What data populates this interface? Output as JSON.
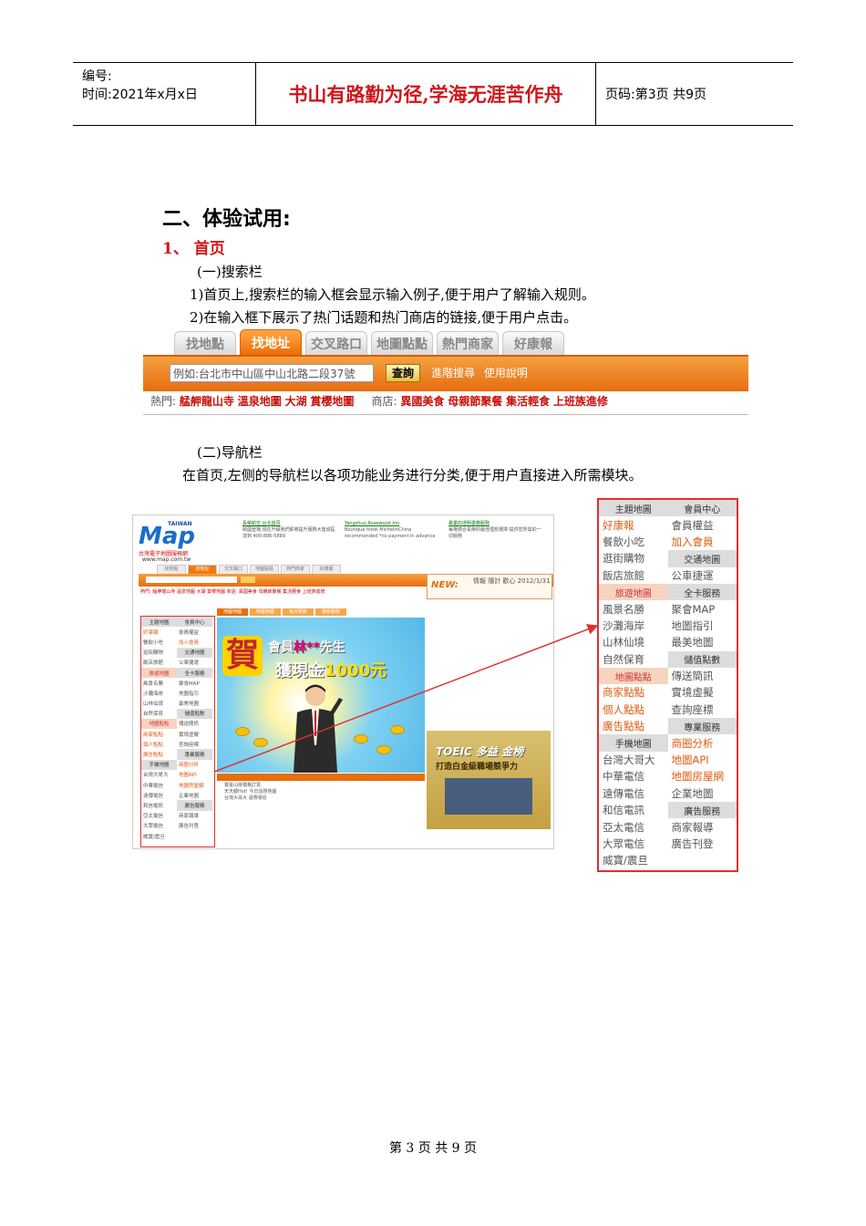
{
  "header": {
    "code_label": "编号:",
    "time_label": "时间:2021年x月x日",
    "motto": "书山有路勤为径,学海无涯苦作舟",
    "page_label": "页码:第3页 共9页"
  },
  "section_title": "二、体验试用:",
  "sub_title": "1、 首页",
  "search_heading": "(一)搜索栏",
  "search_point1": "1)首页上,搜索栏的输入框会显示输入例子,便于用户了解输入规则。",
  "search_point2": "2)在输入框下展示了热门话题和热门商店的链接,便于用户点击。",
  "search_ui": {
    "tabs": [
      "找地點",
      "找地址",
      "交叉路口",
      "地圖點點",
      "熱門商家",
      "好康報"
    ],
    "active_tab": "找地址",
    "input_placeholder": "例如:台北市中山區中山北路二段37號",
    "search_button": "查詢",
    "advanced_link": "進階搜尋",
    "help_link": "使用說明",
    "hot_label": "熱門:",
    "hot_links": [
      "艋舺龍山寺",
      "溫泉地圖",
      "大湖",
      "賞櫻地圖"
    ],
    "shop_label": "商店:",
    "shop_links": [
      "異國美食",
      "母親節聚餐",
      "集活輕食",
      "上班族進修"
    ]
  },
  "nav_heading": "(二)导航栏",
  "nav_desc": "在首页,左侧的导航栏以各项功能业务进行分类,便于用户直接进入所需模块。",
  "screenshot": {
    "logo_word": "Map",
    "logo_top": "TAIWAN",
    "logo_sub": "台灣電子地圖服務網",
    "logo_url": "www.map.com.tw",
    "ad1_title": "長榮航空 台北首頁",
    "ad1_text": "跨國登場,現在升級我們即將提升服務大陸城區達到 400-886-5889",
    "ad2_title": "Yangshuo Rosewood Inn",
    "ad2_text": "Boutique hotel MichelinChina recommended *no payment in advance",
    "ad3_title": "專業的證明書籍服務",
    "ad3_text": "每場適合長榮的最佳理想選擇 提供您所需的一切服務",
    "mini_tabs": [
      "找地點",
      "找地址",
      "交叉路口",
      "地圖點點",
      "熱門商家",
      "好康報"
    ],
    "mini_hot": "熱門: 艋舺龍山寺 溫泉地圖 大湖 賞櫻地圖   商店: 異國美食 母親節聚餐 集活輕食 上班族進修",
    "news_label": "NEW:",
    "news_text": "情報 隨計 歡心 2012/1/31",
    "banner_tabs": [
      "地圖地圖",
      "節慶節慶",
      "每日更新",
      "最新動態"
    ],
    "banner_he": "賀",
    "banner_line1a": "會員",
    "banner_line1b": "林**",
    "banner_line1c": "先生",
    "banner_line2a": "獲現金",
    "banner_line2b": "1000元",
    "hot_map": "熱門地圖",
    "list_text": "賣金山房價格訂貨\n天天都Hot! 今日話題地圖\n台灣大哥大 遠傳電信",
    "toeic_title": "TOEIC 多益 金榜",
    "toeic_sub": "打造白金級職場競爭力"
  },
  "nav_rows": [
    {
      "l": "主題地圖",
      "lt": "h",
      "r": "會員中心",
      "rt": "h"
    },
    {
      "l": "好康報",
      "lt": "or",
      "r": "會員權益",
      "rt": ""
    },
    {
      "l": "餐飲小吃",
      "lt": "",
      "r": "加入會員",
      "rt": "or"
    },
    {
      "l": "逛街購物",
      "lt": "",
      "r": "交通地圖",
      "rt": "h"
    },
    {
      "l": "飯店旅館",
      "lt": "",
      "r": "公車捷運",
      "rt": ""
    },
    {
      "l": "旅遊地圖",
      "lt": "hp",
      "r": "全卡服務",
      "rt": "h"
    },
    {
      "l": "風景名勝",
      "lt": "",
      "r": "聚會MAP",
      "rt": ""
    },
    {
      "l": "沙灘海岸",
      "lt": "",
      "r": "地圖指引",
      "rt": ""
    },
    {
      "l": "山林仙境",
      "lt": "",
      "r": "最美地圖",
      "rt": ""
    },
    {
      "l": "自然保育",
      "lt": "",
      "r": "儲值點數",
      "rt": "h"
    },
    {
      "l": "地圖點點",
      "lt": "hp",
      "r": "傳送簡訊",
      "rt": ""
    },
    {
      "l": "商家點點",
      "lt": "or",
      "r": "實境虛擬",
      "rt": ""
    },
    {
      "l": "個人點點",
      "lt": "or",
      "r": "查詢座標",
      "rt": ""
    },
    {
      "l": "廣告點點",
      "lt": "or",
      "r": "專業服務",
      "rt": "h"
    },
    {
      "l": "手機地圖",
      "lt": "h",
      "r": "商圈分析",
      "rt": "or"
    },
    {
      "l": "台灣大哥大",
      "lt": "",
      "r": "地圖API",
      "rt": "or"
    },
    {
      "l": "中華電信",
      "lt": "",
      "r": "地圖房屋網",
      "rt": "or"
    },
    {
      "l": "遠傳電信",
      "lt": "",
      "r": "企業地圖",
      "rt": ""
    },
    {
      "l": "和信電訊",
      "lt": "",
      "r": "廣告服務",
      "rt": "h"
    },
    {
      "l": "亞太電信",
      "lt": "",
      "r": "商家報導",
      "rt": ""
    },
    {
      "l": "大眾電信",
      "lt": "",
      "r": "廣告刊登",
      "rt": ""
    },
    {
      "l": "威寶/震旦",
      "lt": "",
      "r": "",
      "rt": ""
    }
  ],
  "footer": "第 3 页 共 9 页",
  "colors": {
    "accent_red": "#d0161b",
    "orange": "#e56e10",
    "highlight_box": "#e03030"
  }
}
